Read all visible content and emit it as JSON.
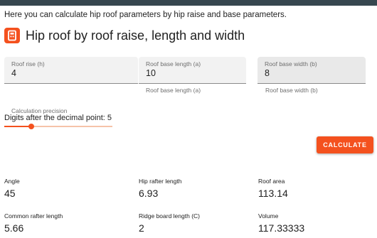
{
  "intro": "Here you can calculate hip roof parameters by hip raise and base parameters.",
  "title": "Hip roof by roof raise, length and width",
  "accent_color": "#f4511e",
  "logo_icon": "calculator-logo-icon",
  "inputs": {
    "roof_rise": {
      "label": "Roof rise (h)",
      "value": "4"
    },
    "base_length": {
      "label": "Roof base length (a)",
      "value": "10",
      "hint": "Roof base length (a)"
    },
    "base_width": {
      "label": "Roof base width (b)",
      "value": "8",
      "hint": "Roof base width (b)"
    }
  },
  "precision": {
    "label": "Calculation precision",
    "text": "Digits after the decimal point: 5",
    "fraction": 0.25
  },
  "calculate_label": "CALCULATE",
  "results": {
    "angle": {
      "label": "Angle",
      "value": "45"
    },
    "hip_rafter": {
      "label": "Hip rafter length",
      "value": "6.93"
    },
    "roof_area": {
      "label": "Roof area",
      "value": "113.14"
    },
    "common_rafter": {
      "label": "Common rafter length",
      "value": "5.66"
    },
    "ridge_board": {
      "label": "Ridge board length (C)",
      "value": "2"
    },
    "volume": {
      "label": "Volume",
      "value": "117.33333"
    }
  }
}
